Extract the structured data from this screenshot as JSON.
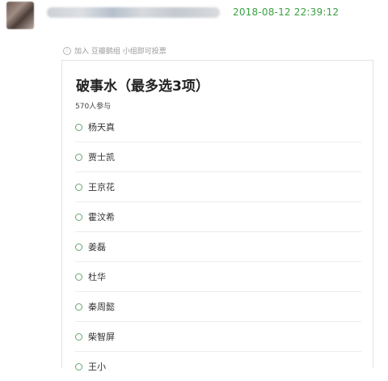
{
  "post": {
    "timestamp": "2018-08-12 22:39:12"
  },
  "hint": {
    "icon": "info-icon",
    "text": "加入 豆瓣鹅组 小组即可投票"
  },
  "poll": {
    "title": "破事水（最多选3项）",
    "participants": "570人参与",
    "options": [
      {
        "label": "杨天真"
      },
      {
        "label": "贾士凯"
      },
      {
        "label": "王京花"
      },
      {
        "label": "霍汶希"
      },
      {
        "label": "姜磊"
      },
      {
        "label": "杜华"
      },
      {
        "label": "秦周懿"
      },
      {
        "label": "柴智屏"
      },
      {
        "label": "王小"
      }
    ]
  },
  "colors": {
    "accent": "#3aa142",
    "radio": "#6aa36f"
  }
}
